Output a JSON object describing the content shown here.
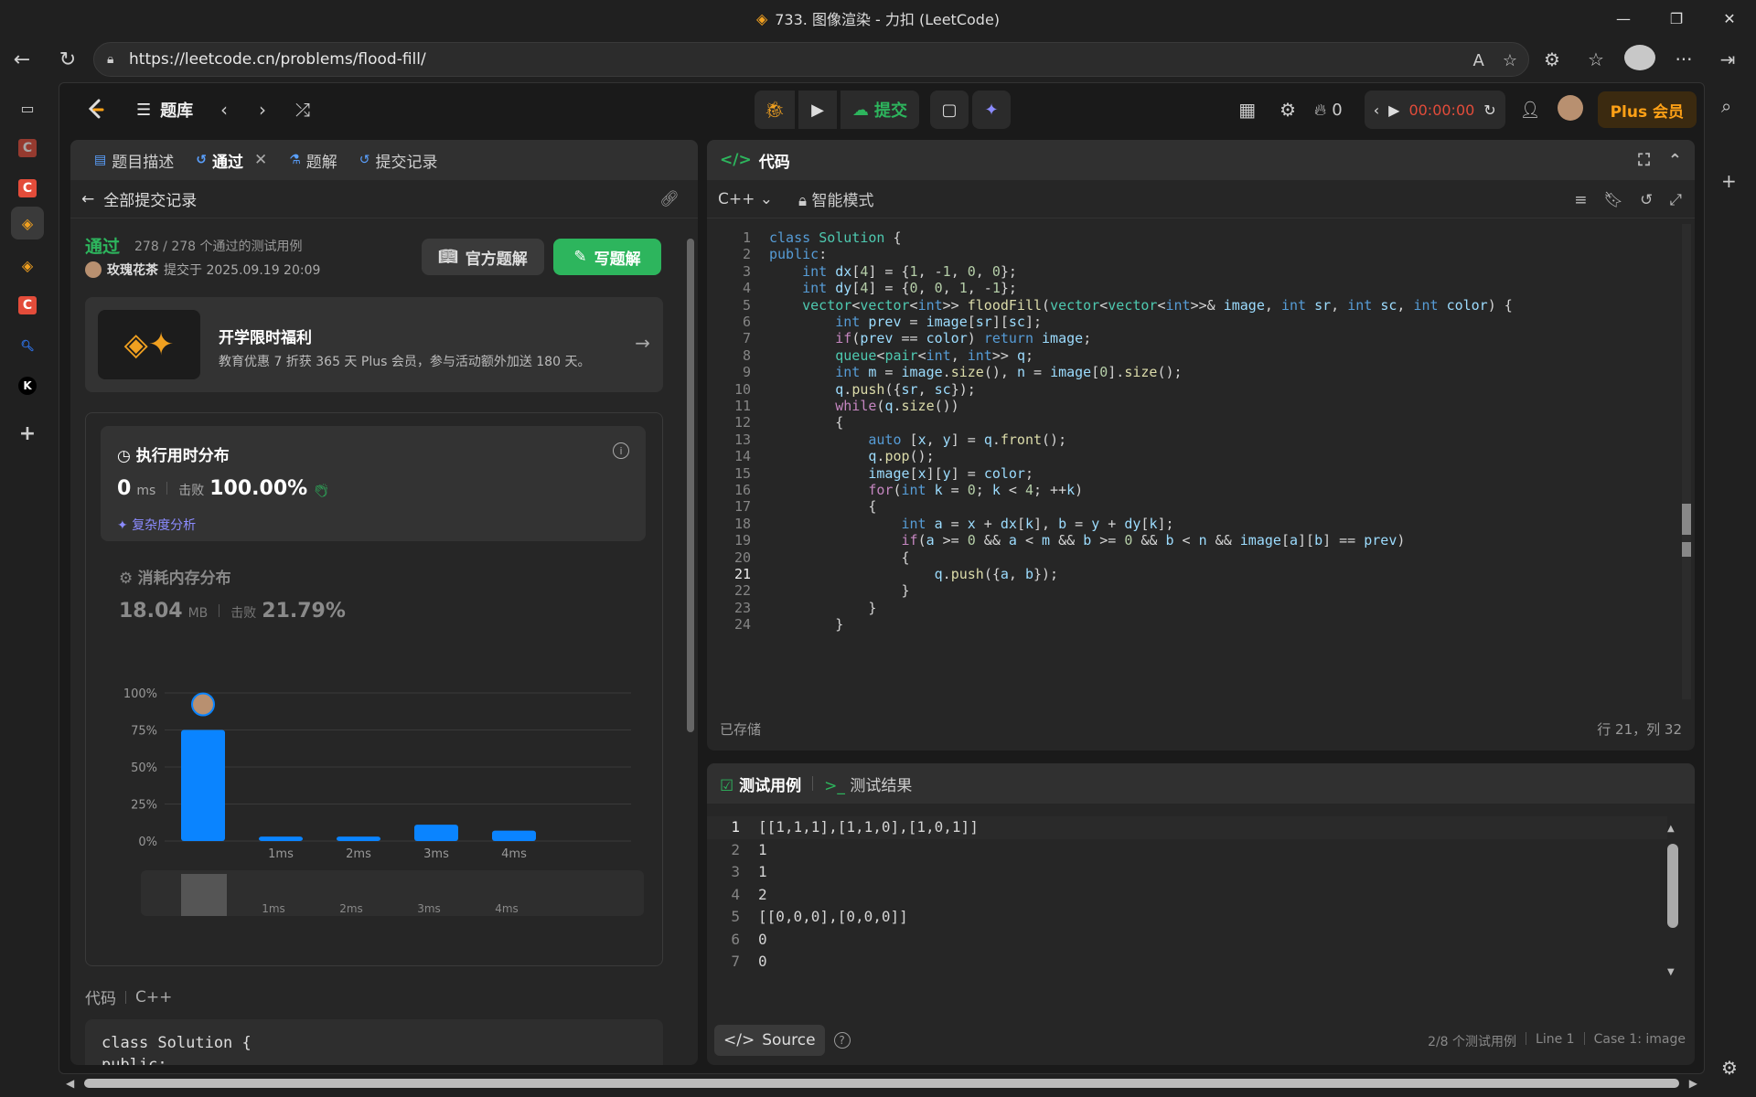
{
  "window": {
    "title": "733. 图像渲染 - 力扣 (LeetCode)"
  },
  "browser": {
    "url": "https://leetcode.cn/problems/flood-fill/"
  },
  "app": {
    "nav_label": "题库",
    "submit_label": "提交",
    "streak": "0",
    "timer": "00:00:00",
    "plus_label": "Plus 会员"
  },
  "left_tabs": [
    {
      "label": "题目描述"
    },
    {
      "label": "通过"
    },
    {
      "label": "题解"
    },
    {
      "label": "提交记录"
    }
  ],
  "submission": {
    "back_label": "全部提交记录",
    "status": "通过",
    "testcases": "278 / 278 个通过的测试用例",
    "user": "玫瑰花茶",
    "submitted": "提交于 2025.09.19 20:09",
    "official_btn": "官方题解",
    "write_btn": "写题解"
  },
  "promo": {
    "title": "开学限时福利",
    "subtitle": "教育优惠 7 折获 365 天 Plus 会员，参与活动额外加送 180 天。"
  },
  "runtime": {
    "title": "执行用时分布",
    "value": "0",
    "unit": "ms",
    "beats_label": "击败",
    "beats": "100.00%",
    "complexity": "复杂度分析"
  },
  "memory": {
    "title": "消耗内存分布",
    "value": "18.04",
    "unit": "MB",
    "beats_label": "击败",
    "beats": "21.79%"
  },
  "chart_data": {
    "type": "bar",
    "categories": [
      "0ms",
      "1ms",
      "2ms",
      "3ms",
      "4ms"
    ],
    "tick_labels": [
      "",
      "1ms",
      "2ms",
      "3ms",
      "4ms"
    ],
    "values": [
      75,
      3,
      3,
      11,
      7
    ],
    "y_ticks": [
      "100%",
      "75%",
      "50%",
      "25%",
      "0%"
    ],
    "ylim": [
      0,
      100
    ],
    "bar_color": "#0a84ff",
    "grid": true,
    "marker_on": "0ms"
  },
  "code_preview": {
    "label": "代码",
    "lang": "C++",
    "line1": "class Solution {",
    "line2": "public:"
  },
  "editor": {
    "title": "代码",
    "lang": "C++",
    "mode": "智能模式",
    "status": "已存储",
    "cursor": "行 21，列 32",
    "lines": [
      "class Solution {",
      "public:",
      "    int dx[4] = {1, -1, 0, 0};",
      "    int dy[4] = {0, 0, 1, -1};",
      "    vector<vector<int>> floodFill(vector<vector<int>>& image, int sr, int sc, int color) {",
      "        int prev = image[sr][sc];",
      "        if(prev == color) return image;",
      "        queue<pair<int, int>> q;",
      "        int m = image.size(), n = image[0].size();",
      "        q.push({sr, sc});",
      "        while(q.size())",
      "        {",
      "            auto [x, y] = q.front();",
      "            q.pop();",
      "            image[x][y] = color;",
      "            for(int k = 0; k < 4; ++k)",
      "            {",
      "                int a = x + dx[k], b = y + dy[k];",
      "                if(a >= 0 && a < m && b >= 0 && b < n && image[a][b] == prev)",
      "                {",
      "                    q.push({a, b});",
      "                }",
      "            }",
      "        }"
    ]
  },
  "testcase": {
    "tab1": "测试用例",
    "tab2": "测试结果",
    "lines": [
      "[[1,1,1],[1,1,0],[1,0,1]]",
      "1",
      "1",
      "2",
      "[[0,0,0],[0,0,0]]",
      "0",
      "0"
    ],
    "source_label": "Source",
    "count": "2/8 个测试用例",
    "line_info": "Line 1",
    "case_info": "Case 1: image"
  }
}
